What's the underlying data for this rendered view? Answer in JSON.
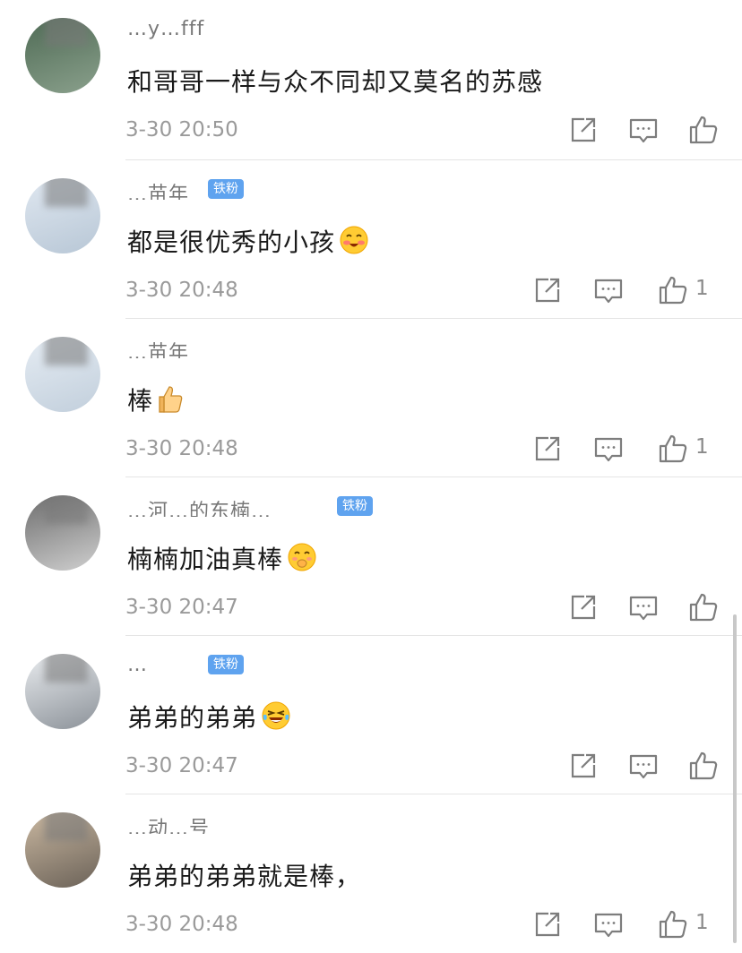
{
  "comments": [
    {
      "username": "…y…fff",
      "badge": "",
      "text": "和哥哥一样与众不同却又莫名的苏感",
      "emoji": "",
      "time": "3-30 20:50",
      "likes": ""
    },
    {
      "username": "…苗年",
      "badge": "铁粉",
      "text": "都是很优秀的小孩",
      "emoji": "blush-smile-emoji",
      "time": "3-30 20:48",
      "likes": "1"
    },
    {
      "username": "…苗年",
      "badge": "",
      "text": "棒",
      "emoji": "thumbs-up-emoji",
      "time": "3-30 20:48",
      "likes": "1"
    },
    {
      "username": "…河…的东楠…",
      "badge": "铁粉",
      "text": "楠楠加油真棒",
      "emoji": "shush-face-emoji",
      "time": "3-30 20:47",
      "likes": ""
    },
    {
      "username": "…",
      "badge": "铁粉",
      "text": "弟弟的弟弟",
      "emoji": "laugh-tears-emoji",
      "time": "3-30 20:47",
      "likes": ""
    },
    {
      "username": "…动…号",
      "badge": "",
      "text": "弟弟的弟弟就是棒，",
      "emoji": "",
      "time": "3-30 20:48",
      "likes": "1"
    }
  ],
  "colors": {
    "badge": "#5fa3ef",
    "text": "#1a1a1a",
    "meta": "#9a9a9a",
    "icon": "#7d7d7d"
  },
  "icons": [
    "share-icon",
    "reply-icon",
    "like-icon"
  ]
}
